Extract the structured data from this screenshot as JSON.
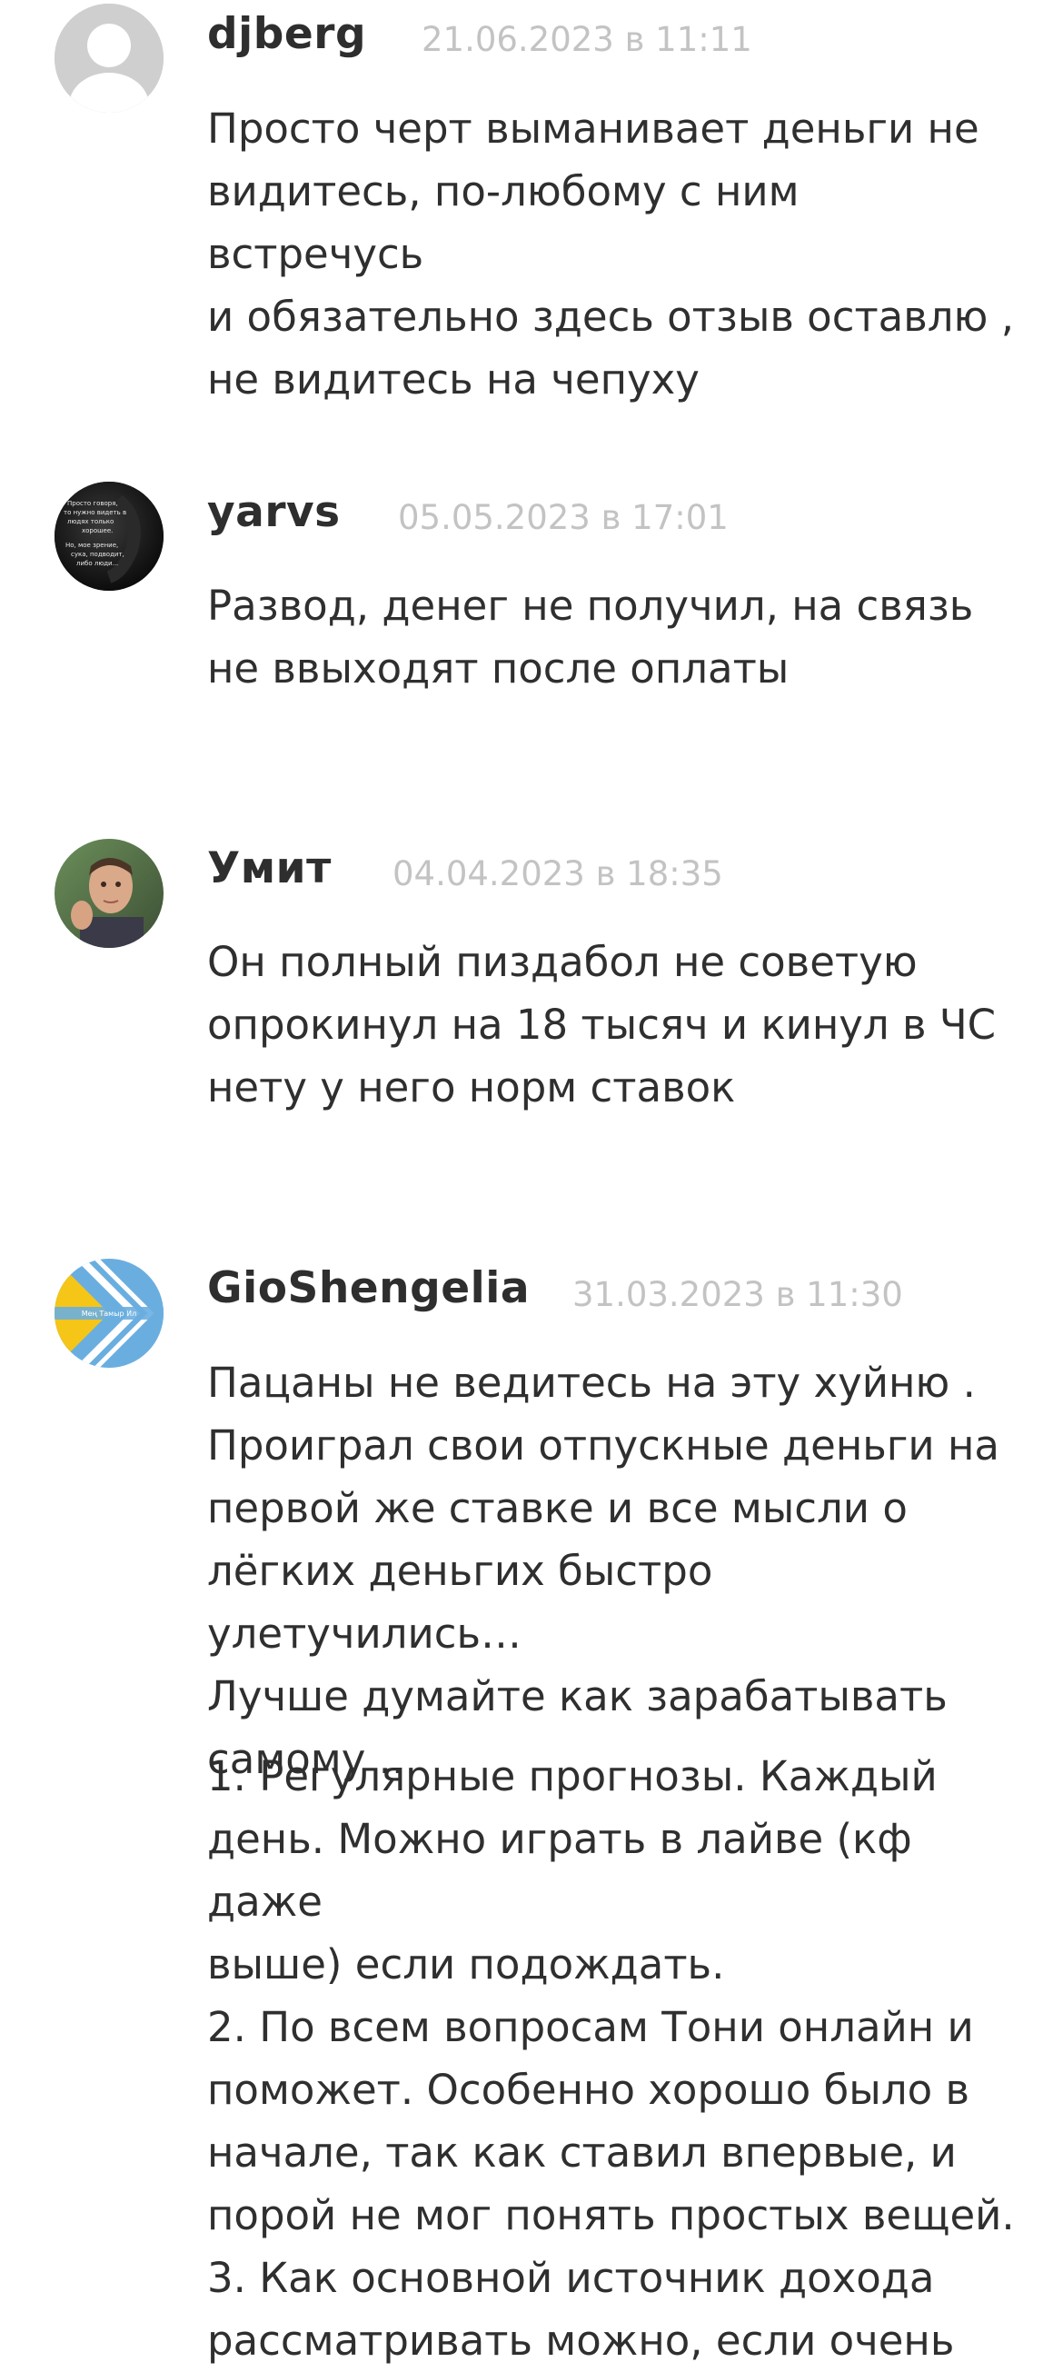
{
  "comments": [
    {
      "author": "djberg",
      "date": "21.06.2023 в 11:11",
      "text": "Просто черт выманивает деньги не\nвидитесь, по-любому с ним встречусь\nи обязательно здесь отзыв оставлю ,\nне видитесь на чепуху",
      "avatar": "default-user-avatar"
    },
    {
      "author": "yarvs",
      "date": "05.05.2023 в 17:01",
      "text": "Развод, денег не получил, на связь\nне ввыходят после оплаты",
      "avatar": "dark-quote-avatar",
      "avatar_text": "Просто говоря, то нужно видеть в людях только хорошее. Но, мое зрение, сука, подводит, либо люди..."
    },
    {
      "author": "Умит",
      "date": "04.04.2023 в 18:35",
      "text": "Он полный пиздабол не советую\nопрокинул на 18 тысяч и кинул в ЧС\nнету у него норм ставок",
      "avatar": "photo-avatar"
    },
    {
      "author": "GioShengelia",
      "date": "31.03.2023 в 11:30",
      "text": "Пацаны не ведитесь на эту хуйню .\nПроиграл свои отпускные деньги на\nпервой же ставке и все мысли о\nлёгких деньгих быстро улетучились…\nЛучше думайте как зарабатывать\nсамому ..",
      "text_2": "1. Регулярные прогнозы. Каждый\nдень. Можно играть в лайве (кф даже\nвыше) если подождать.\n2. По всем вопросам Тони онлайн и\nпоможет. Особенно хорошо было в\nначале, так как ставил впервые, и\nпорой не мог понять простых вещей.\n3. Как основной источник дохода\nрассматривать можно, если очень",
      "avatar": "flag-emblem-avatar",
      "avatar_text": "Мең Тамыр Ил"
    }
  ],
  "colors": {
    "author": "#2e2e2e",
    "date": "#c3c3c3",
    "text": "#2f2f2f",
    "flag_yellow": "#f5c518",
    "flag_blue": "#6aaee0"
  }
}
